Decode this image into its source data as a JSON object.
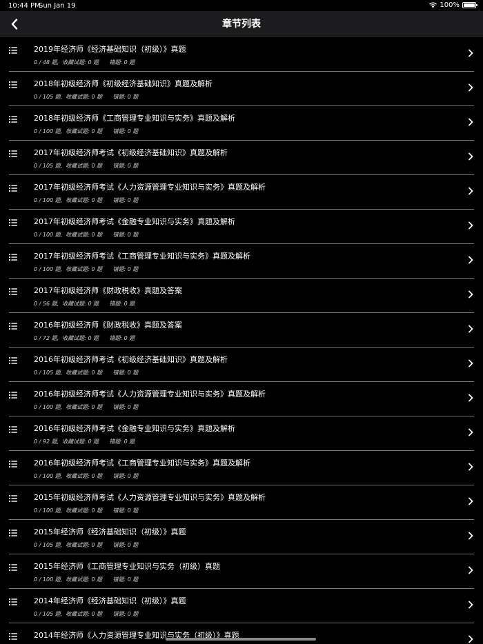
{
  "status": {
    "time": "10:44 PM",
    "date": "Sun Jan 19",
    "battery": "100%"
  },
  "nav": {
    "title": "章节列表"
  },
  "chapters": [
    {
      "title": "2019年经济师《经济基础知识（初级）》真题",
      "subtitle": "0 / 48 题,  收藏试题: 0 题      错题: 0 题"
    },
    {
      "title": "2018年初级经济师《初级经济基础知识》真题及解析",
      "subtitle": "0 / 105 题,  收藏试题: 0 题      错题: 0 题"
    },
    {
      "title": "2018年初级经济师《工商管理专业知识与实务》真题及解析",
      "subtitle": "0 / 100 题,  收藏试题: 0 题      错题: 0 题"
    },
    {
      "title": "2017年初级经济师考试《初级经济基础知识》真题及解析",
      "subtitle": "0 / 105 题,  收藏试题: 0 题      错题: 0 题"
    },
    {
      "title": "2017年初级经济师考试《人力资源管理专业知识与实务》真题及解析",
      "subtitle": "0 / 100 题,  收藏试题: 0 题      错题: 0 题"
    },
    {
      "title": "2017年初级经济师考试《金融专业知识与实务》真题及解析",
      "subtitle": "0 / 100 题,  收藏试题: 0 题      错题: 0 题"
    },
    {
      "title": "2017年初级经济师考试《工商管理专业知识与实务》真题及解析",
      "subtitle": "0 / 100 题,  收藏试题: 0 题      错题: 0 题"
    },
    {
      "title": "2017年初级经济师《财政税收》真题及答案",
      "subtitle": "0 / 56 题,  收藏试题: 0 题      错题: 0 题"
    },
    {
      "title": "2016年初级经济师《财政税收》真题及答案",
      "subtitle": "0 / 72 题,  收藏试题: 0 题      错题: 0 题"
    },
    {
      "title": "2016年初级经济师考试《初级经济基础知识》真题及解析",
      "subtitle": "0 / 105 题,  收藏试题: 0 题      错题: 0 题"
    },
    {
      "title": "2016年初级经济师考试《人力资源管理专业知识与实务》真题及解析",
      "subtitle": "0 / 100 题,  收藏试题: 0 题      错题: 0 题"
    },
    {
      "title": "2016年初级经济师考试《金融专业知识与实务》真题及解析",
      "subtitle": "0 / 92 题,  收藏试题: 0 题      错题: 0 题"
    },
    {
      "title": "2016年初级经济师考试《工商管理专业知识与实务》真题及解析",
      "subtitle": "0 / 100 题,  收藏试题: 0 题      错题: 0 题"
    },
    {
      "title": "2015年初级经济师考试《人力资源管理专业知识与实务》真题及解析",
      "subtitle": "0 / 100 题,  收藏试题: 0 题      错题: 0 题"
    },
    {
      "title": "2015年经济师《经济基础知识（初级）》真题",
      "subtitle": "0 / 105 题,  收藏试题: 0 题      错题: 0 题"
    },
    {
      "title": "2015年经济师《工商管理专业知识与实务（初级）真题",
      "subtitle": "0 / 100 题,  收藏试题: 0 题      错题: 0 题"
    },
    {
      "title": "2014年经济师《经济基础知识（初级）》真题",
      "subtitle": "0 / 105 题,  收藏试题: 0 题      错题: 0 题"
    },
    {
      "title": "2014年经济师《人力资源管理专业知识与实务（初级）》真题",
      "subtitle": ""
    }
  ]
}
